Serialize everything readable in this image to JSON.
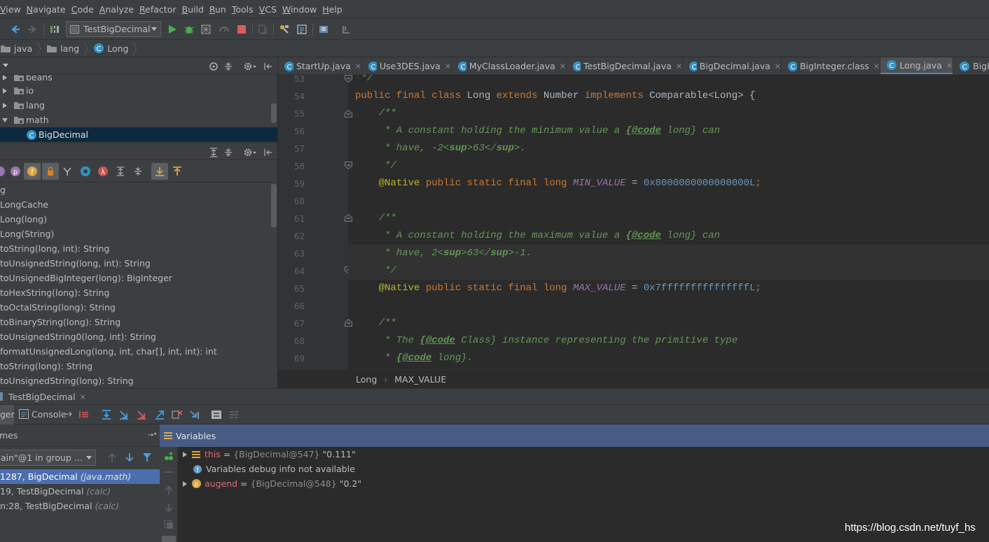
{
  "menu": [
    "View",
    "Navigate",
    "Code",
    "Analyze",
    "Refactor",
    "Build",
    "Run",
    "Tools",
    "VCS",
    "Window",
    "Help"
  ],
  "toolbar": {
    "run_config": "TestBigDecimal"
  },
  "breadcrumb": [
    "java",
    "lang",
    "Long"
  ],
  "project_tree": {
    "items": [
      {
        "label": "beans",
        "expanded": false
      },
      {
        "label": "io",
        "expanded": false
      },
      {
        "label": "lang",
        "expanded": false
      },
      {
        "label": "math",
        "expanded": true
      },
      {
        "label": "BigDecimal",
        "selected": true
      }
    ]
  },
  "structure": {
    "items": [
      "g",
      "LongCache",
      "Long(long)",
      "Long(String)",
      "toString(long, int): String",
      "toUnsignedString(long, int): String",
      "toUnsignedBigInteger(long): BigInteger",
      "toHexString(long): String",
      "toOctalString(long): String",
      "toBinaryString(long): String",
      "toUnsignedString0(long, int): String",
      "formatUnsignedLong(long, int, char[], int, int): int",
      "toString(long): String",
      "toUnsignedString(long): String"
    ]
  },
  "editor_tabs": [
    {
      "label": "StartUp.java",
      "close": "×"
    },
    {
      "label": "Use3DES.java",
      "close": "×"
    },
    {
      "label": "MyClassLoader.java",
      "close": "×"
    },
    {
      "label": "TestBigDecimal.java",
      "close": "×"
    },
    {
      "label": "BigDecimal.java",
      "close": "×"
    },
    {
      "label": "BigInteger.class",
      "close": "×"
    },
    {
      "label": "Long.java",
      "close": "×",
      "active": true
    },
    {
      "label": "BigI",
      "close": ""
    }
  ],
  "editor": {
    "line_numbers": [
      "53",
      "54",
      "55",
      "56",
      "57",
      "58",
      "59",
      "60",
      "61",
      "62",
      "63",
      "64",
      "65",
      "66",
      "67",
      "68",
      "69"
    ],
    "current_line": "63"
  },
  "editor_crumbs": {
    "class": "Long",
    "member": "MAX_VALUE"
  },
  "debug": {
    "title": "TestBigDecimal",
    "close": "×",
    "tabs": {
      "debugger": "ger",
      "console": "Console"
    },
    "frames_label": "mes",
    "variables_label": "Variables",
    "thread": "ain\"@1 in group ...",
    "frames": [
      {
        "method": "1287, BigDecimal",
        "loc": "(java.math)",
        "selected": true
      },
      {
        "method": "19, TestBigDecimal",
        "loc": "(calc)"
      },
      {
        "method": "n:28, TestBigDecimal",
        "loc": "(calc)"
      }
    ],
    "variables": [
      {
        "name": "this",
        "eq": " = ",
        "type": "{BigDecimal@547}",
        "value": " \"0.111\""
      },
      {
        "info": "Variables debug info not available"
      },
      {
        "name": "augend",
        "eq": " = ",
        "type": "{BigDecimal@548}",
        "value": " \"0.2\""
      }
    ]
  },
  "watermark": "https://blog.csdn.net/tuyf_hs",
  "colors": {
    "keyword": "#cc7832",
    "comment": "#629755",
    "annotation": "#bbb529",
    "field": "#9876aa",
    "number": "#6897bb",
    "accent": "#4a88c7"
  }
}
